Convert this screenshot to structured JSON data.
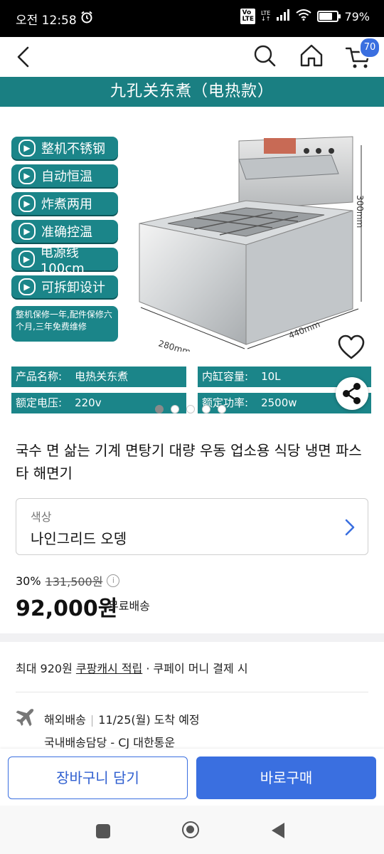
{
  "status_bar": {
    "time": "오전 12:58",
    "network": "LTE",
    "battery": "79%",
    "battery_level": 0.79
  },
  "header": {
    "cart_count": "70"
  },
  "product_image": {
    "banner": "九孔关东煮（电热款）",
    "features": [
      "整机不锈钢",
      "自动恒温",
      "炸煮两用",
      "准确控温",
      "电源线100cm",
      "可拆卸设计"
    ],
    "warranty": "整机保修一年,配件保修六个月,三年免费维修",
    "dimensions": {
      "width": "280mm",
      "depth": "440mm",
      "height": "300mm"
    },
    "specs": [
      {
        "key": "产品名称:",
        "value": "电热关东煮"
      },
      {
        "key": "内缸容量:",
        "value": "10L"
      },
      {
        "key": "额定电压:",
        "value": "220v"
      },
      {
        "key": "额定功率:",
        "value": "2500w"
      }
    ],
    "carousel": {
      "count": 5,
      "active": 0
    }
  },
  "product": {
    "title": "국수 면 삶는 기계 면탕기 대량 우동 업소용 식당 냉면 파스타 해면기",
    "option_label": "색상",
    "option_value": "나인그리드 오뎅",
    "discount_rate": "30%",
    "original_price": "131,500원",
    "price": "92,000원",
    "shipping_fee": "무료배송"
  },
  "benefits": {
    "prefix": "최대 920원 ",
    "link": "쿠팡캐시 적립",
    "suffix": " · 쿠페이 머니 결제 시"
  },
  "delivery": {
    "type": "해외배송",
    "separator": "|",
    "eta": "11/25(월) 도착 예정",
    "courier": "국내배송담당 - CJ 대한통운"
  },
  "actions": {
    "add_to_cart": "장바구니 담기",
    "buy_now": "바로구매"
  },
  "colors": {
    "accent": "#3a6fe0",
    "teal": "#1b8589"
  }
}
